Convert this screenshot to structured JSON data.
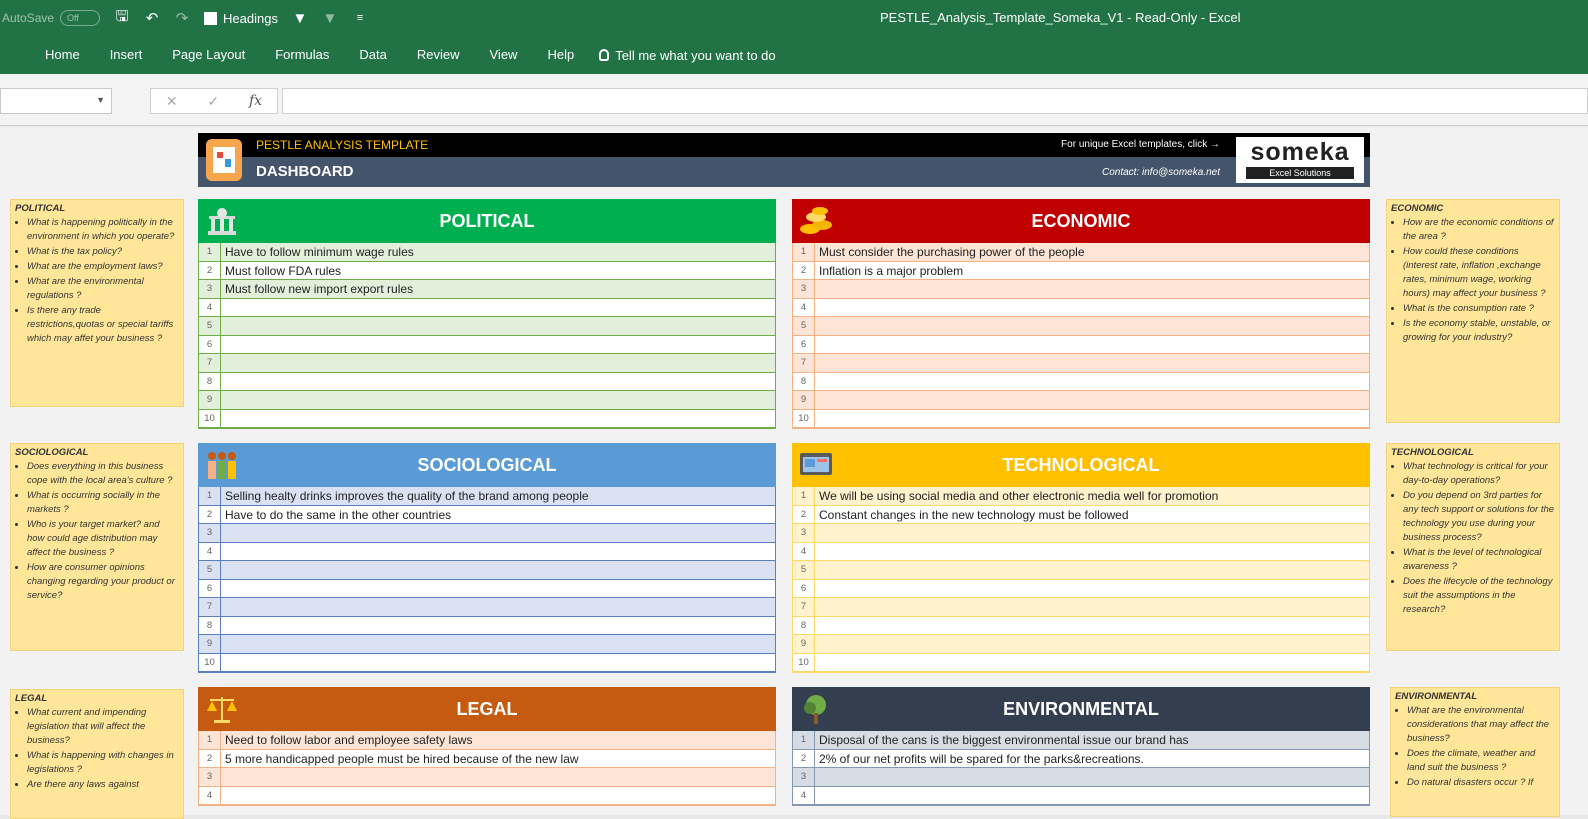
{
  "titlebar": {
    "autosave_label": "AutoSave",
    "autosave_state": "Off",
    "headings_label": "Headings",
    "document_title": "PESTLE_Analysis_Template_Someka_V1  -  Read-Only  -  Excel"
  },
  "ribbon": {
    "tabs": [
      "Home",
      "Insert",
      "Page Layout",
      "Formulas",
      "Data",
      "Review",
      "View",
      "Help"
    ],
    "tell_me": "Tell me what you want to do"
  },
  "formula": {
    "fx": "fx",
    "cancel": "✕",
    "enter": "✓"
  },
  "header": {
    "title": "PESTLE ANALYSIS TEMPLATE",
    "dashboard": "DASHBOARD",
    "promo": "For unique Excel templates, click →",
    "contact": "Contact: info@someka.net",
    "brand_name": "someka",
    "brand_sub": "Excel Solutions"
  },
  "notes": {
    "political": {
      "title": "POLITICAL",
      "items": [
        "What is happening politically in the environment in which you operate?",
        "What is the tax policy?",
        "What are the employment laws?",
        "What are the environmental regulations ?",
        "Is there any trade restrictions,quotas or special tariffs which may affet your business ?"
      ]
    },
    "economic": {
      "title": "ECONOMIC",
      "items": [
        "How are the economic conditions of the area ?",
        "How could these conditions (interest rate, inflation ,exchange rates, minimum wage, working hours) may affect your business ?",
        "What is the consumption rate ?",
        "Is the economy stable, unstable, or growing for your industry?"
      ]
    },
    "sociological": {
      "title": "SOCIOLOGICAL",
      "items": [
        "Does everything in this business cope with the local area's culture ?",
        "What is occurring socially in the markets ?",
        "Who is your target market? and how could age distribution may affect the business ?",
        "How are consumer opinions changing regarding your product or service?"
      ]
    },
    "technological": {
      "title": "TECHNOLOGICAL",
      "items": [
        "What technology is critical for your day-to-day operations?",
        "Do you depend on 3rd parties for any tech support or solutions for the technology you use during your business process?",
        "What is the level of technological awareness ?",
        "Does the lifecycle of the technology suit the assumptions in the research?"
      ]
    },
    "legal": {
      "title": "LEGAL",
      "items": [
        "What current and impending legislation that will affect the business?",
        "What is happening with changes in legislations ?",
        "Are there any laws against"
      ]
    },
    "environmental": {
      "title": "ENVIRONMENTAL",
      "items": [
        "What are the environmental considerations that may affect the business?",
        "Does the climate, weather and land suit the business ?",
        "Do  natural disasters occur ? If"
      ]
    }
  },
  "panels": {
    "political": {
      "title": "POLITICAL",
      "rows": [
        {
          "n": "1",
          "t": "Have to follow minimum wage rules"
        },
        {
          "n": "2",
          "t": "Must follow FDA rules"
        },
        {
          "n": "3",
          "t": "Must follow new import export rules"
        },
        {
          "n": "4",
          "t": ""
        },
        {
          "n": "5",
          "t": ""
        },
        {
          "n": "6",
          "t": ""
        },
        {
          "n": "7",
          "t": ""
        },
        {
          "n": "8",
          "t": ""
        },
        {
          "n": "9",
          "t": ""
        },
        {
          "n": "10",
          "t": ""
        }
      ]
    },
    "economic": {
      "title": "ECONOMIC",
      "rows": [
        {
          "n": "1",
          "t": "Must consider the purchasing power of the people"
        },
        {
          "n": "2",
          "t": "Inflation is a major problem"
        },
        {
          "n": "3",
          "t": ""
        },
        {
          "n": "4",
          "t": ""
        },
        {
          "n": "5",
          "t": ""
        },
        {
          "n": "6",
          "t": ""
        },
        {
          "n": "7",
          "t": ""
        },
        {
          "n": "8",
          "t": ""
        },
        {
          "n": "9",
          "t": ""
        },
        {
          "n": "10",
          "t": ""
        }
      ]
    },
    "sociological": {
      "title": "SOCIOLOGICAL",
      "rows": [
        {
          "n": "1",
          "t": "Selling healty drinks improves the quality of the brand among people"
        },
        {
          "n": "2",
          "t": "Have to do the same in the other countries"
        },
        {
          "n": "3",
          "t": ""
        },
        {
          "n": "4",
          "t": ""
        },
        {
          "n": "5",
          "t": ""
        },
        {
          "n": "6",
          "t": ""
        },
        {
          "n": "7",
          "t": ""
        },
        {
          "n": "8",
          "t": ""
        },
        {
          "n": "9",
          "t": ""
        },
        {
          "n": "10",
          "t": ""
        }
      ]
    },
    "technological": {
      "title": "TECHNOLOGICAL",
      "rows": [
        {
          "n": "1",
          "t": "We will be using social media and other electronic media well for promotion"
        },
        {
          "n": "2",
          "t": "Constant changes in the new technology must be followed"
        },
        {
          "n": "3",
          "t": ""
        },
        {
          "n": "4",
          "t": ""
        },
        {
          "n": "5",
          "t": ""
        },
        {
          "n": "6",
          "t": ""
        },
        {
          "n": "7",
          "t": ""
        },
        {
          "n": "8",
          "t": ""
        },
        {
          "n": "9",
          "t": ""
        },
        {
          "n": "10",
          "t": ""
        }
      ]
    },
    "legal": {
      "title": "LEGAL",
      "rows": [
        {
          "n": "1",
          "t": "Need to follow labor and employee safety laws"
        },
        {
          "n": "2",
          "t": "5 more handicapped people must be hired because of the new law"
        },
        {
          "n": "3",
          "t": ""
        },
        {
          "n": "4",
          "t": ""
        }
      ]
    },
    "environmental": {
      "title": "ENVIRONMENTAL",
      "rows": [
        {
          "n": "1",
          "t": "Disposal of the cans is the biggest environmental issue our brand has"
        },
        {
          "n": "2",
          "t": "2% of our net profits will be spared for the parks&recreations."
        },
        {
          "n": "3",
          "t": ""
        },
        {
          "n": "4",
          "t": ""
        }
      ]
    }
  }
}
